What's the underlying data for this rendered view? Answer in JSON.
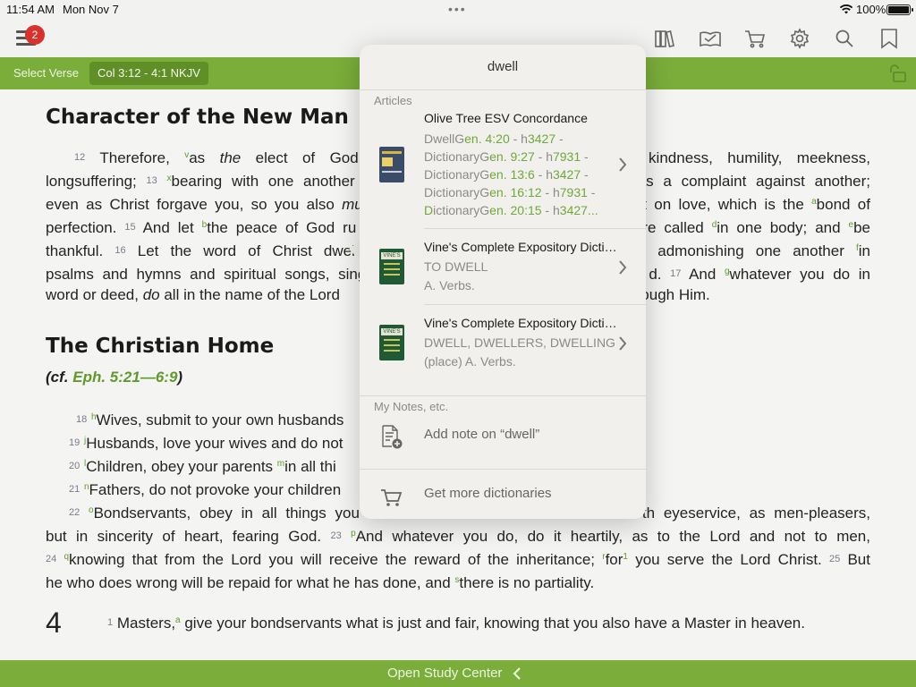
{
  "status_bar": {
    "time": "11:54 AM",
    "date": "Mon Nov 7",
    "battery": "100%"
  },
  "toolbar": {
    "menu_badge": "2",
    "icons": [
      "library-icon",
      "reading-plan-icon",
      "store-cart-icon",
      "settings-gear-icon",
      "search-icon",
      "bookmark-icon"
    ]
  },
  "verse_bar": {
    "select_verse": "Select Verse",
    "reference": "Col 3:12 - 4:1 NKJV"
  },
  "content": {
    "heading1": "Character of the New Man",
    "heading2": "The Christian Home",
    "cf_prefix": "(",
    "cf_label": "cf.",
    "cf_link": "Eph. 5:21—6:9",
    "cf_suffix": ")",
    "lines": {
      "l1": {
        "v": "12",
        "t1": "Therefore, ",
        "fn": "v",
        "t2": "as ",
        "em": "the",
        "t3": " elect of God, holy",
        "t4": "kindness, humility, meekness,"
      },
      "l2": {
        "t1": "longsuffering;",
        "v": "13",
        "fn": "x",
        "t2": "bearing with one another",
        "t3": "as a complaint against another;"
      },
      "l3": {
        "t1": "even as Christ forgave you, so you also ",
        "em": "mus",
        "t2": "t on love, which is the ",
        "fn": "a",
        "t3": "bond of"
      },
      "l4": {
        "t1": "perfection.",
        "v": "15",
        "t2": "And let ",
        "fn": "b",
        "t3": "the peace of God ru",
        "t4": "re called ",
        "fn2": "d",
        "t5": "in one body; and ",
        "fn3": "e",
        "t6": "be"
      },
      "l5": {
        "t1": "thankful.",
        "v": "16",
        "t2": "Let the word of Christ dwell",
        "t3": "d admonishing one another ",
        "fn": "f",
        "t4": "in"
      },
      "l6": {
        "t1": "psalms and hymns and spiritual songs, sing",
        "t2": "d.",
        "v": "17",
        "t3": "And ",
        "fn": "g",
        "t4": "whatever you do in"
      },
      "l7": {
        "t1": "word or deed, ",
        "em": "do",
        "t2": " all in the name of the Lord ",
        "t3": "rough Him."
      },
      "l8": {
        "v": "18",
        "fn": "h",
        "t1": "Wives, submit to your own husbands"
      },
      "l9": {
        "v": "19",
        "fn": "j",
        "t1": "Husbands, love your wives and do not"
      },
      "l10": {
        "v": "20",
        "fn": "l",
        "t1": "Children, obey your parents ",
        "fn2": "m",
        "t2": "in all thi"
      },
      "l11": {
        "v": "21",
        "fn": "n",
        "t1": "Fathers, do not provoke your children"
      },
      "l12": {
        "v": "22",
        "fn": "o",
        "t1": "Bondservants, obey in all things you",
        "t2": "th eyeservice, as men-pleasers,"
      },
      "l13": {
        "t1": "but in sincerity of heart, fearing God.",
        "v": "23",
        "fn": "p",
        "t2": "And whatever you do, do it heartily, as to the Lord and not to men,"
      },
      "l14": {
        "v": "24",
        "fn": "q",
        "t1": "knowing that from the Lord you will receive the reward of the inheritance; ",
        "fn2": "r",
        "t2": "for",
        "fn3": "1",
        "t3": " you serve the Lord Christ.",
        "v2": "25",
        "t4": "But"
      },
      "l15": {
        "t1": "he who does wrong will be repaid for what he has done, and ",
        "fn": "s",
        "t2": "there is no partiality."
      },
      "l16": {
        "chapter": "4",
        "v": "1",
        "t1": "Masters,",
        "fn": "a",
        "t2": " give your bondservants what is just and fair, knowing that you also have a Master in heaven."
      }
    }
  },
  "popover": {
    "title": "dwell",
    "articles_label": "Articles",
    "entries": [
      {
        "title": "Olive Tree ESV Concordance",
        "sub1_a": "DwellG",
        "sub1_b": "en. 4:20",
        "sub1_c": " - h",
        "sub1_d": "3427",
        "sub1_e": " -",
        "sub2_a": "DictionaryG",
        "sub2_b": "en. 9:27",
        "sub2_c": " - h",
        "sub2_d": "7931",
        "sub2_e": " -",
        "sub3_a": "DictionaryG",
        "sub3_b": "en. 13:6",
        "sub3_c": " - h",
        "sub3_d": "3427",
        "sub3_e": " -",
        "sub4_a": "DictionaryG",
        "sub4_b": "en. 16:12",
        "sub4_c": " - h",
        "sub4_d": "7931",
        "sub4_e": " -",
        "sub5_a": "D",
        "sub5_b": "ictionaryG",
        "sub5_c": "en. 20:15",
        "sub5_d": " - h",
        "sub5_e": "3427..."
      },
      {
        "title": "Vine's Complete Expository Dictionary",
        "sub1": "TO DWELL",
        "sub2": "A. Verbs."
      },
      {
        "title": "Vine's Complete Expository Dictionary",
        "sub1": "DWELL, DWELLERS, DWELLING",
        "sub2": "(place) A. Verbs."
      }
    ],
    "notes_label": "My Notes, etc.",
    "add_note": "Add note on “dwell”",
    "more_dictionaries": "Get more dictionaries"
  },
  "bottom_bar": {
    "open_study_center": "Open Study Center"
  },
  "colors": {
    "accent_green": "#7aad3a",
    "badge_red": "#d8322c",
    "link_green": "#5f9a2a"
  }
}
